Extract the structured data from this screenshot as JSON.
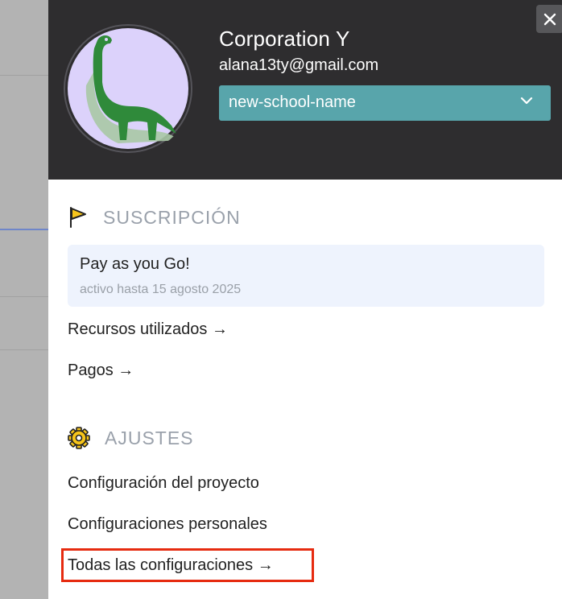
{
  "header": {
    "org_name": "Corporation Y",
    "email": "alana13ty@gmail.com",
    "school_select": {
      "selected": "new-school-name"
    }
  },
  "subscription": {
    "title": "SUSCRIPCIÓN",
    "plan_name": "Pay as you Go!",
    "active_until": "activo hasta 15 agosto 2025",
    "links": [
      "Recursos utilizados →",
      "Pagos →"
    ]
  },
  "settings": {
    "title": "AJUSTES",
    "links": [
      "Configuración del proyecto",
      "Configuraciones personales",
      "Todas las configuraciones →"
    ]
  },
  "colors": {
    "header_bg": "#2e2d2f",
    "select_bg": "#58a5ab",
    "plan_card_bg": "#eef3fd",
    "highlight": "#e62b10",
    "avatar_bg": "#dcd2fb",
    "dino": "#2f8a3a"
  },
  "icons": [
    "close-icon",
    "chevron-down-icon",
    "flag-icon",
    "gear-icon",
    "dinosaur-avatar"
  ]
}
